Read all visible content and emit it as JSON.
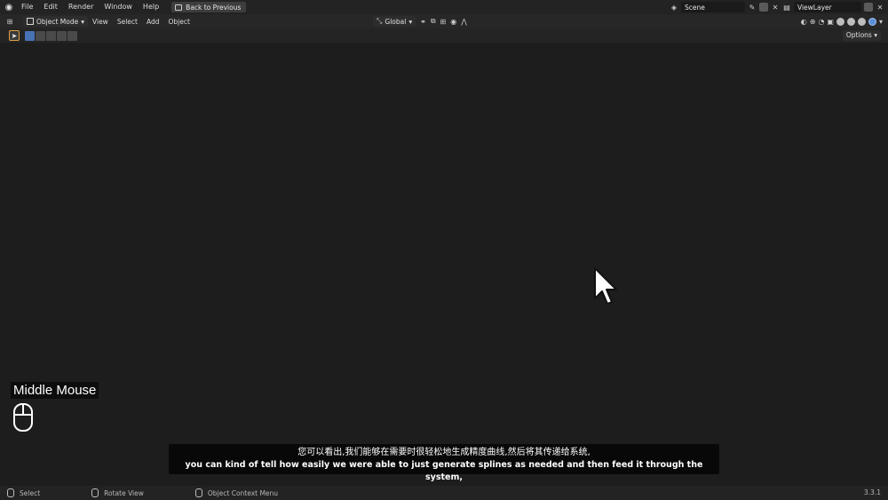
{
  "app": {
    "menu": [
      "File",
      "Edit",
      "Render",
      "Window",
      "Help"
    ],
    "back_button": "Back to Previous",
    "scene_name": "Scene",
    "view_layer": "ViewLayer"
  },
  "viewport_header": {
    "mode": "Object Mode",
    "menus": [
      "View",
      "Select",
      "Add",
      "Object"
    ],
    "orientation": "Global",
    "options": "Options"
  },
  "overlay": {
    "mouse_hint": "Middle Mouse",
    "subtitle_cn": "您可以看出,我们能够在需要时很轻松地生成精度曲线,然后将其传递给系统,",
    "subtitle_en": "you can kind of tell how easily we were able to just generate splines as needed and then feed it through the system,"
  },
  "statusbar": {
    "items": [
      "Select",
      "Rotate View",
      "Object Context Menu"
    ],
    "version": "3.3.1"
  },
  "colors": {
    "accent": "#4772b3",
    "header_bg": "#232323",
    "viewport_bg": "#2b2b2b",
    "foliage": "#a9b04a",
    "bark": "#6b5a45",
    "ground": "#dfe2e6"
  }
}
